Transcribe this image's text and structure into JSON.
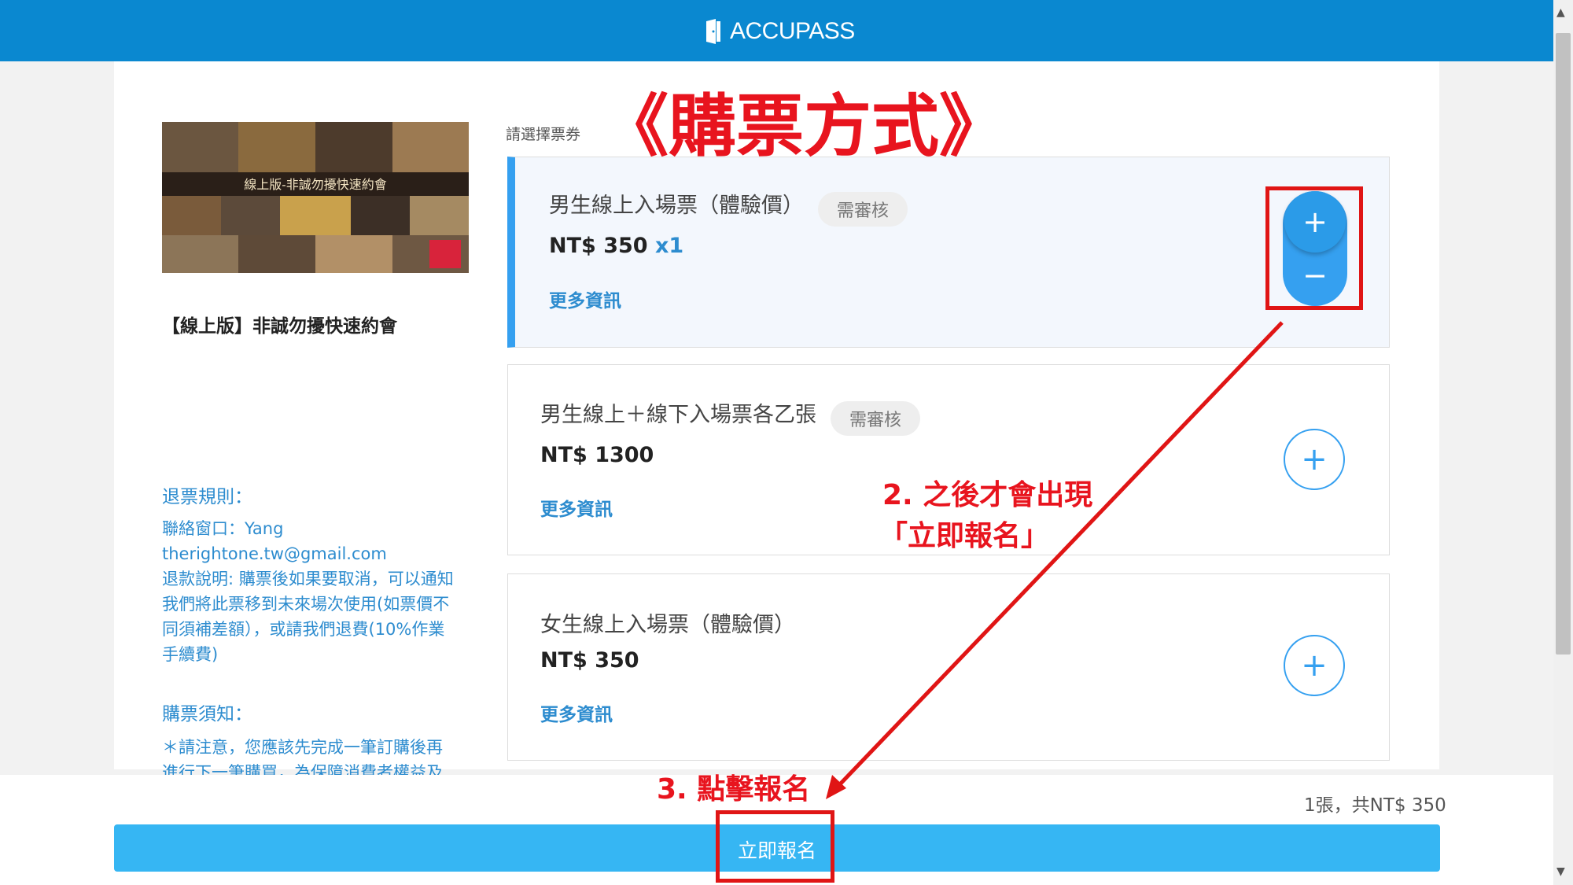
{
  "header": {
    "brand": "ACCUPASS"
  },
  "annotations": {
    "title": "《購票方式》",
    "step2_line1": "2. 之後才會出現",
    "step2_line2": "「立即報名」",
    "step3": "3. 點擊報名"
  },
  "event": {
    "banner_text": "線上版-非誠勿擾快速約會",
    "title": "【線上版】非誠勿擾快速約會"
  },
  "refund": {
    "heading": "退票規則：",
    "contact": "聯絡窗口：Yang",
    "email": "therightone.tw@gmail.com",
    "policy_lines": [
      "退款說明: 購票後如果要取消，可以通知",
      "我們將此票移到未來場次使用(如票價不",
      "同須補差額），或請我們退費(10%作業",
      "手續費)"
    ]
  },
  "notice": {
    "heading": "購票須知：",
    "lines": [
      "＊請注意，您應該先完成一筆訂購後再",
      "進行下一筆購買，為保障消費者權益及"
    ]
  },
  "select_label": "請選擇票券",
  "tickets": [
    {
      "name": "男生線上入場票（體驗價）",
      "badge": "需審核",
      "price": "NT$ 350",
      "qty": "x1",
      "more": "更多資訊",
      "selected": true
    },
    {
      "name": "男生線上＋線下入場票各乙張",
      "badge": "需審核",
      "price": "NT$ 1300",
      "more": "更多資訊",
      "selected": false
    },
    {
      "name": "女生線上入場票（體驗價）",
      "price": "NT$ 350",
      "more": "更多資訊",
      "selected": false
    }
  ],
  "stepper": {
    "plus": "+",
    "minus": "−"
  },
  "footer": {
    "summary": "1張，共NT$ 350",
    "cta": "立即報名"
  },
  "colors": {
    "header": "#0a88d0",
    "accent": "#35a0f0",
    "cta": "#36b6f3",
    "annotation": "#e8141e"
  }
}
